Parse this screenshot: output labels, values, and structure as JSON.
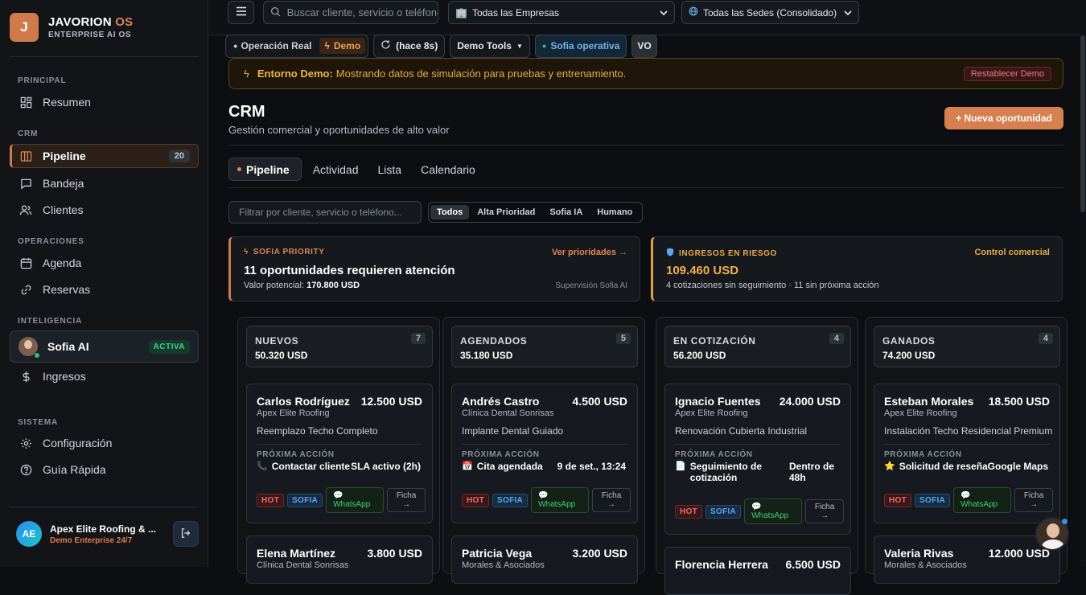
{
  "brand": {
    "initial": "J",
    "name": "JAVORION",
    "name_suffix": "OS",
    "sub": "ENTERPRISE AI OS"
  },
  "sidebar": {
    "sections": {
      "principal": "PRINCIPAL",
      "crm": "CRM",
      "operaciones": "OPERACIONES",
      "inteligencia": "INTELIGENCIA",
      "sistema": "SISTEMA"
    },
    "items": {
      "resumen": "Resumen",
      "pipeline": "Pipeline",
      "pipeline_count": "20",
      "bandeja": "Bandeja",
      "clientes": "Clientes",
      "agenda": "Agenda",
      "reservas": "Reservas",
      "sofia": "Sofia AI",
      "sofia_status": "ACTIVA",
      "ingresos": "Ingresos",
      "configuracion": "Configuración",
      "guia": "Guía Rápida"
    },
    "account": {
      "initials": "AE",
      "name": "Apex Elite Roofing & ...",
      "plan": "Demo Enterprise 24/7"
    }
  },
  "topbar": {
    "search_placeholder": "Buscar cliente, servicio o teléfono",
    "company_select": "Todas las Empresas",
    "site_select": "Todas las Sedes (Consolidado)"
  },
  "status": {
    "real": "Operación Real",
    "demo": "Demo",
    "sync": "(hace 8s)",
    "tools": "Demo Tools",
    "sofia": "Sofia operativa",
    "user": "VO"
  },
  "banner": {
    "label": "Entorno Demo:",
    "text": "Mostrando datos de simulación para pruebas y entrenamiento.",
    "reset": "Restablecer Demo"
  },
  "page": {
    "title": "CRM",
    "subtitle": "Gestión comercial y oportunidades de alto valor",
    "new_button": "+ Nueva oportunidad"
  },
  "tabs": [
    "Pipeline",
    "Actividad",
    "Lista",
    "Calendario"
  ],
  "filter": {
    "placeholder": "Filtrar por cliente, servicio o teléfono...",
    "chips": [
      "Todos",
      "Alta Prioridad",
      "Sofia IA",
      "Humano"
    ]
  },
  "kpis": {
    "priority": {
      "head": "SOFIA PRIORITY",
      "link": "Ver prioridades →",
      "main": "11 oportunidades requieren atención",
      "sub_label": "Valor potencial:",
      "sub_value": "170.800 USD",
      "foot": "Supervisión Sofia AI"
    },
    "risk": {
      "head": "INGRESOS EN RIESGO",
      "link": "Control comercial",
      "main": "109.460 USD",
      "sub": "4 cotizaciones sin seguimiento · 11 sin próxima acción"
    }
  },
  "columns": [
    {
      "name": "NUEVOS",
      "total": "50.320 USD",
      "count": "7",
      "card": {
        "name": "Carlos Rodríguez",
        "amount": "12.500 USD",
        "company": "Apex Elite Roofing",
        "service": "Reemplazo Techo Completo",
        "action": "Contactar cliente",
        "due": "SLA activo (2h)"
      },
      "next": {
        "name": "Elena Martínez",
        "amount": "3.800 USD",
        "company": "Clínica Dental Sonrisas"
      }
    },
    {
      "name": "AGENDADOS",
      "total": "35.180 USD",
      "count": "5",
      "card": {
        "name": "Andrés Castro",
        "amount": "4.500 USD",
        "company": "Clínica Dental Sonrisas",
        "service": "Implante Dental Guiado",
        "action": "Cita agendada",
        "due": "9 de set., 13:24"
      },
      "next": {
        "name": "Patricia Vega",
        "amount": "3.200 USD",
        "company": "Morales & Asociados"
      }
    },
    {
      "name": "EN COTIZACIÓN",
      "total": "56.200 USD",
      "count": "4",
      "card": {
        "name": "Ignacio Fuentes",
        "amount": "24.000 USD",
        "company": "Apex Elite Roofing",
        "service": "Renovación Cubierta Industrial",
        "action": "Seguimiento de cotización",
        "due": "Dentro de 48h"
      },
      "next": {
        "name": "Florencia Herrera",
        "amount": "6.500 USD",
        "company": ""
      }
    },
    {
      "name": "GANADOS",
      "total": "74.200 USD",
      "count": "4",
      "card": {
        "name": "Esteban Morales",
        "amount": "18.500 USD",
        "company": "Apex Elite Roofing",
        "service": "Instalación Techo Residencial Premium",
        "action": "Solicitud de reseña",
        "due": "Google Maps"
      },
      "next": {
        "name": "Valeria Rivas",
        "amount": "12.000 USD",
        "company": "Morales & Asociados"
      }
    }
  ],
  "card_labels": {
    "next_action": "PRÓXIMA ACCIÓN",
    "hot": "HOT",
    "sofia": "SOFIA",
    "whatsapp": "WhatsApp",
    "ficha": "Ficha",
    "arrow": "→"
  },
  "colors": {
    "accent": "#d07a4b",
    "warning": "#e0a040",
    "success": "#2ec27e",
    "info": "#5aa7ee",
    "danger": "#ef6a6a"
  }
}
